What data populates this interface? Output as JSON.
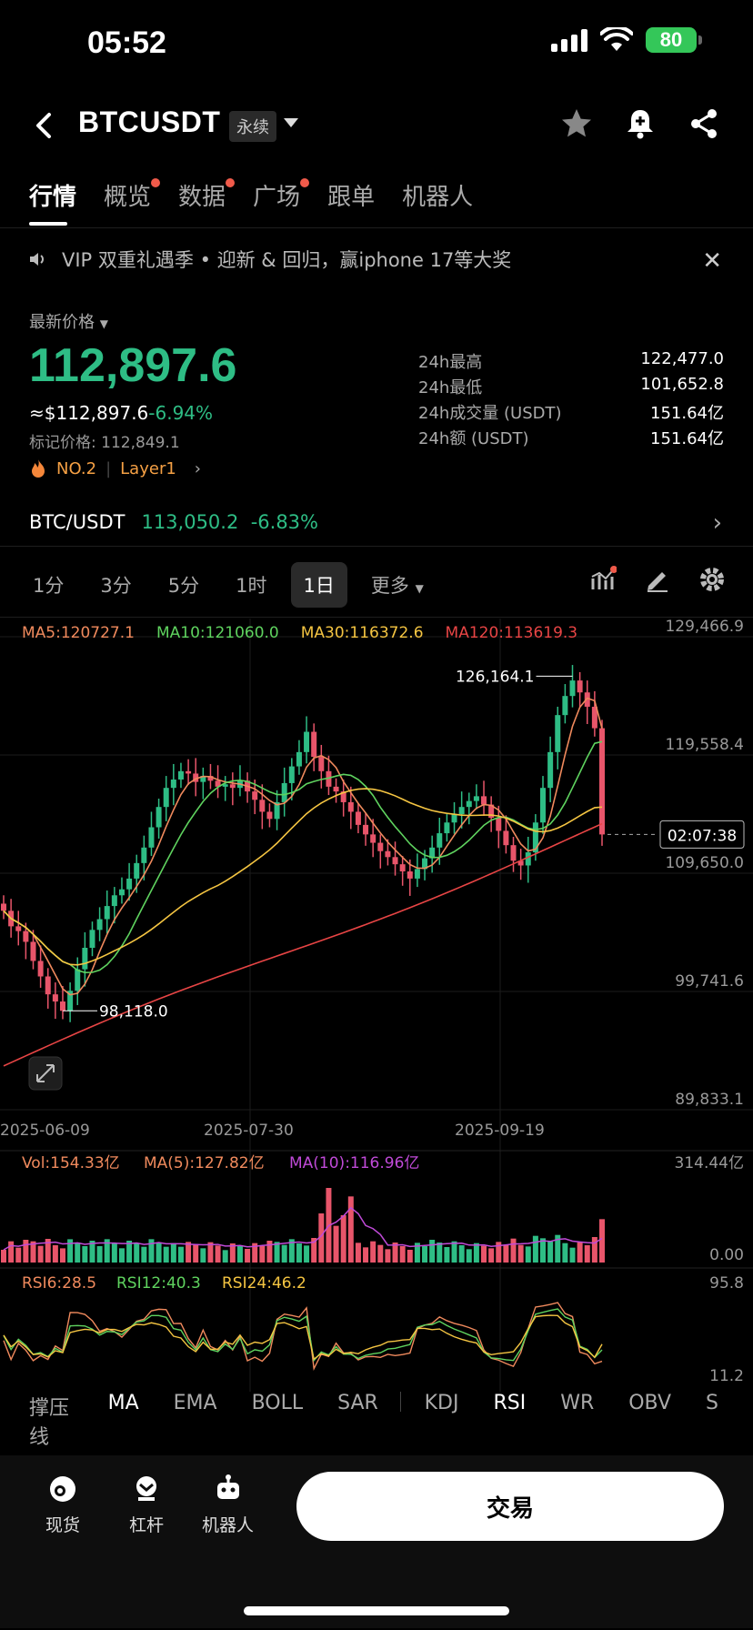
{
  "status_bar": {
    "time": "05:52",
    "battery": "80"
  },
  "header": {
    "symbol": "BTCUSDT",
    "contract_type": "永续"
  },
  "tabs": [
    {
      "label": "行情",
      "active": true,
      "dot": false
    },
    {
      "label": "概览",
      "active": false,
      "dot": true
    },
    {
      "label": "数据",
      "active": false,
      "dot": true
    },
    {
      "label": "广场",
      "active": false,
      "dot": true
    },
    {
      "label": "跟单",
      "active": false,
      "dot": false
    },
    {
      "label": "机器人",
      "active": false,
      "dot": false
    }
  ],
  "banner": {
    "text": "VIP 双重礼遇季 • 迎新 & 回归，赢iphone 17等大奖"
  },
  "price": {
    "label": "最新价格",
    "last": "112,897.6",
    "approx": "≈$112,897.6",
    "change": "-6.94%",
    "mark": "标记价格: 112,849.1",
    "rank": "NO.2",
    "tag": "Layer1"
  },
  "stats": [
    {
      "label": "24h最高",
      "value": "122,477.0"
    },
    {
      "label": "24h最低",
      "value": "101,652.8"
    },
    {
      "label": "24h成交量 (USDT)",
      "value": "151.64亿"
    },
    {
      "label": "24h额 (USDT)",
      "value": "151.64亿"
    }
  ],
  "spot_pair": {
    "name": "BTC/USDT",
    "price": "113,050.2",
    "change": "-6.83%"
  },
  "timeframes": [
    {
      "label": "1分",
      "active": false
    },
    {
      "label": "3分",
      "active": false
    },
    {
      "label": "5分",
      "active": false
    },
    {
      "label": "1时",
      "active": false
    },
    {
      "label": "1日",
      "active": true
    },
    {
      "label": "更多",
      "active": false
    }
  ],
  "ma_legend": [
    {
      "label": "MA5:120727.1",
      "color": "#f08a5d"
    },
    {
      "label": "MA10:121060.0",
      "color": "#5fd35f"
    },
    {
      "label": "MA30:116372.6",
      "color": "#f5c542"
    },
    {
      "label": "MA120:113619.3",
      "color": "#e84545"
    }
  ],
  "chart_data": {
    "type": "candlestick",
    "y_ticks": [
      "129,466.9",
      "119,558.4",
      "109,650.0",
      "99,741.6",
      "89,833.1"
    ],
    "ylim": [
      89833.1,
      129466.9
    ],
    "x_ticks": [
      "2025-06-09",
      "2025-07-30",
      "2025-09-19"
    ],
    "high_label": "126,164.1",
    "low_label": "98,118.0",
    "countdown": "02:07:38",
    "close_series": [
      106500,
      105200,
      104800,
      103900,
      102300,
      101000,
      99500,
      98900,
      98118,
      99800,
      101600,
      103400,
      104900,
      105800,
      106900,
      107800,
      108300,
      109200,
      110500,
      111800,
      113500,
      115200,
      116800,
      117500,
      118200,
      118000,
      117300,
      117800,
      117400,
      116900,
      117100,
      116800,
      117400,
      116500,
      115800,
      114800,
      114200,
      115600,
      117200,
      118600,
      119800,
      121500,
      119400,
      118200,
      116900,
      116500,
      115600,
      114800,
      113700,
      112900,
      112200,
      111500,
      111000,
      110400,
      109800,
      109200,
      110000,
      110900,
      111800,
      113000,
      113900,
      114600,
      115200,
      115700,
      116100,
      115400,
      114300,
      113200,
      112000,
      110700,
      110300,
      111400,
      113900,
      116800,
      119800,
      122900,
      124500,
      125800,
      124800,
      123600,
      121800,
      112897.6
    ],
    "ma_lines": {
      "MA5": "120727.1",
      "MA10": "121060.0",
      "MA30": "116372.6",
      "MA120": "113619.3"
    },
    "volume": {
      "label": "Vol:154.33亿",
      "ma5": "MA(5):127.82亿",
      "ma10": "MA(10):116.96亿",
      "max": "314.44亿",
      "min": "0.00"
    },
    "rsi": {
      "rsi6": "RSI6:28.5",
      "rsi12": "RSI12:40.3",
      "rsi24": "RSI24:46.2",
      "max": "95.8",
      "min": "11.2"
    }
  },
  "indicators": [
    {
      "label": "撑压线",
      "active": false
    },
    {
      "label": "MA",
      "active": true
    },
    {
      "label": "EMA",
      "active": false
    },
    {
      "label": "BOLL",
      "active": false
    },
    {
      "label": "SAR",
      "active": false
    },
    {
      "label": "KDJ",
      "active": false
    },
    {
      "label": "RSI",
      "active": true
    },
    {
      "label": "WR",
      "active": false
    },
    {
      "label": "OBV",
      "active": false
    },
    {
      "label": "S",
      "active": false
    }
  ],
  "bottom_nav": [
    {
      "label": "现货",
      "icon": "spot-icon"
    },
    {
      "label": "杠杆",
      "icon": "margin-icon"
    },
    {
      "label": "机器人",
      "icon": "robot-icon"
    }
  ],
  "trade_button": "交易"
}
